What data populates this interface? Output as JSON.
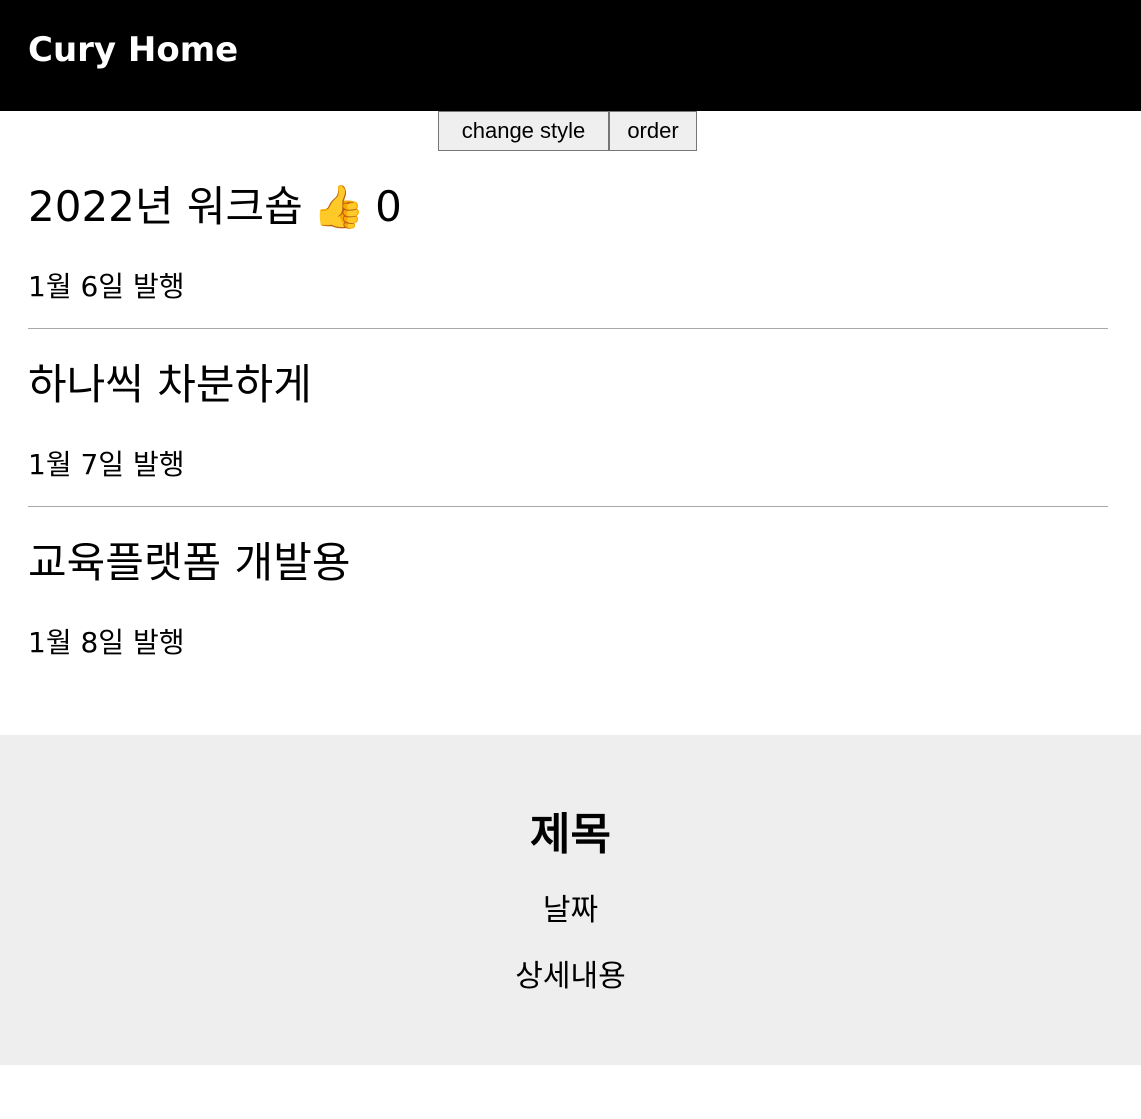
{
  "nav": {
    "title": "Cury Home"
  },
  "toolbar": {
    "change_style_label": "change style",
    "order_label": "order"
  },
  "posts": [
    {
      "title": "2022년 워크숍",
      "like_icon": "👍",
      "like_count": "0",
      "date": "1월 6일 발행"
    },
    {
      "title": "하나씩 차분하게",
      "date": "1월 7일 발행"
    },
    {
      "title": "교육플랫폼 개발용",
      "date": "1월 8일 발행"
    }
  ],
  "modal": {
    "title": "제목",
    "date": "날짜",
    "content": "상세내용"
  },
  "colors": {
    "nav_bg": "#000000",
    "modal_bg": "#eeeeee",
    "like_icon": "#f4b400"
  }
}
